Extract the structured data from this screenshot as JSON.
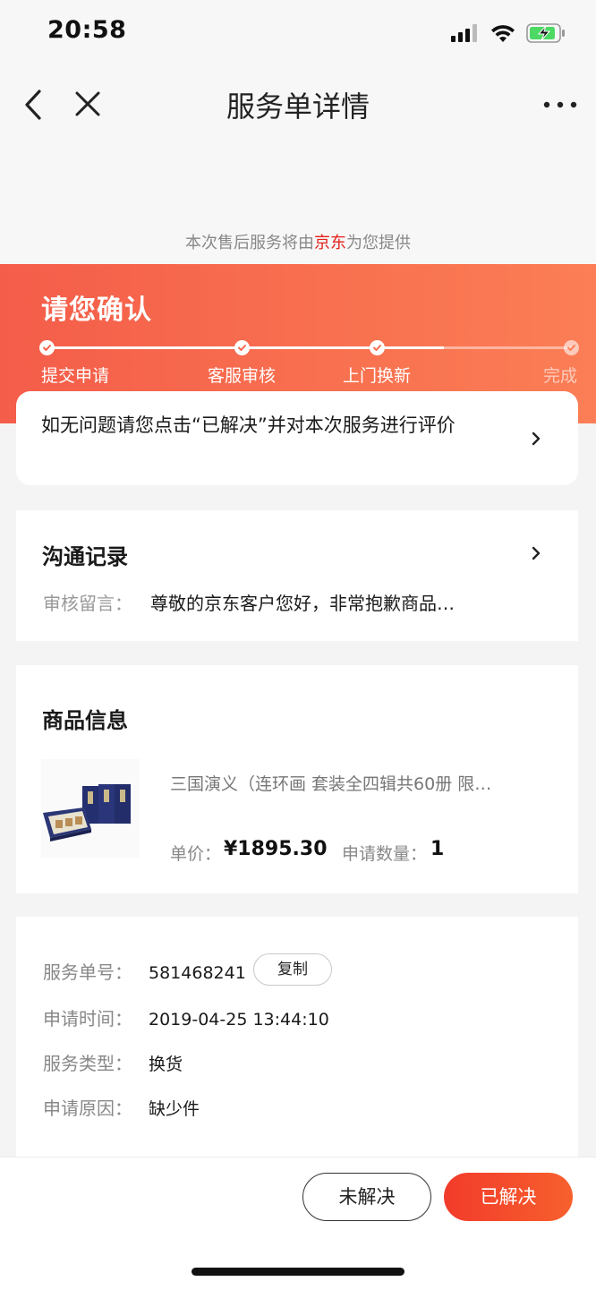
{
  "status_bar": {
    "time": "20:58"
  },
  "nav": {
    "title": "服务单详情"
  },
  "provider": {
    "prefix": "本次售后服务将由",
    "vendor": "京东",
    "suffix": "为您提供"
  },
  "header": {
    "title": "请您确认",
    "steps": [
      {
        "label": "提交申请",
        "done": true
      },
      {
        "label": "客服审核",
        "done": true
      },
      {
        "label": "上门换新",
        "done": true
      },
      {
        "label": "完成",
        "done": false
      }
    ]
  },
  "confirm": {
    "text": "如无问题请您点击“已解决”并对本次服务进行评价"
  },
  "communication": {
    "title": "沟通记录",
    "label": "审核留言：",
    "message": "尊敬的京东客户您好，非常抱歉商品…"
  },
  "product": {
    "title": "商品信息",
    "name": "三国演义（连环画 套装全四辑共60册 限…",
    "price_label": "单价：",
    "price": "¥1895.30",
    "qty_label": "申请数量：",
    "qty": "1"
  },
  "service_info": {
    "order_label": "服务单号：",
    "order_no": "581468241",
    "copy_label": "复制",
    "time_label": "申请时间：",
    "time": "2019-04-25 13:44:10",
    "type_label": "服务类型：",
    "type": "换货",
    "reason_label": "申请原因：",
    "reason": "缺少件"
  },
  "actions": {
    "unresolved": "未解决",
    "resolved": "已解决"
  },
  "colors": {
    "brand_red": "#e2231a",
    "header_orange": "#f8704f"
  }
}
